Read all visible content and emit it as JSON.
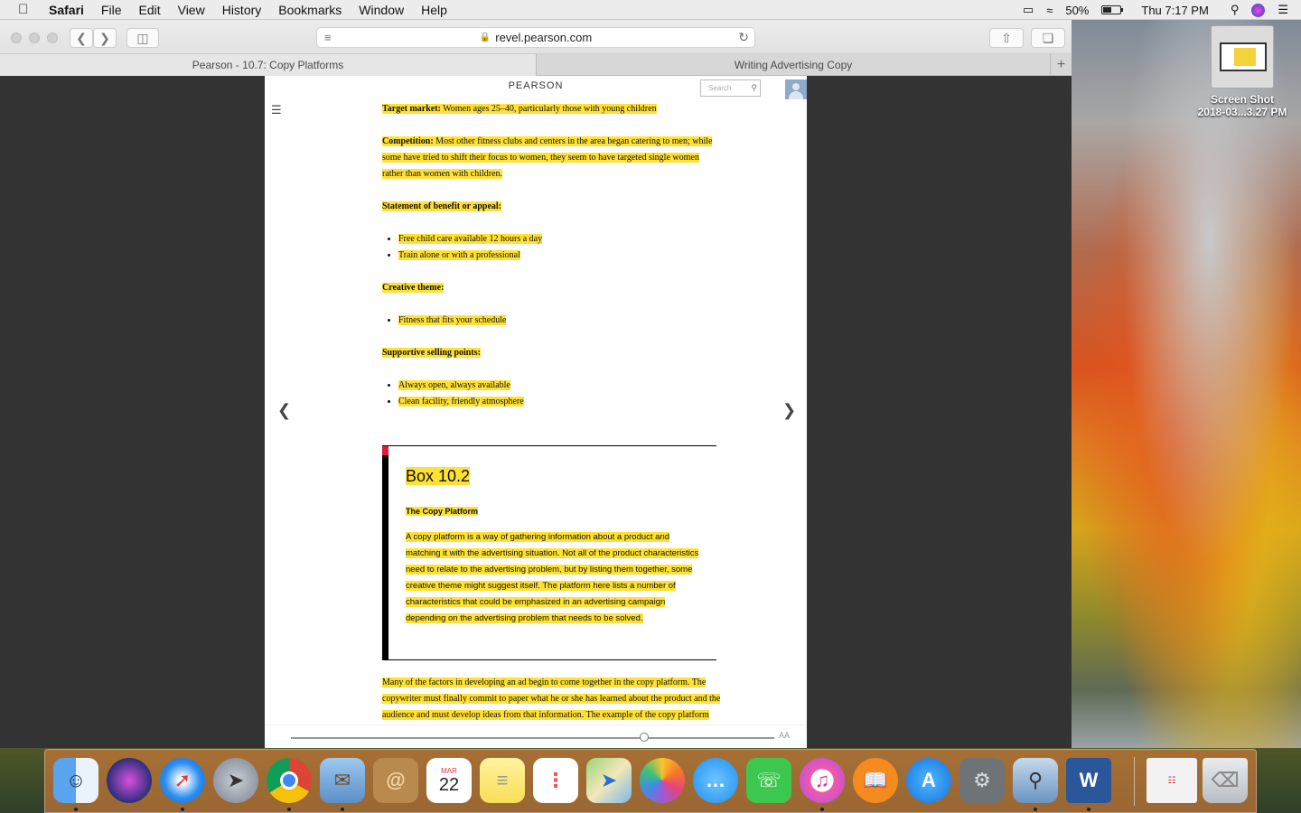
{
  "menubar": {
    "app_name": "Safari",
    "items": [
      "File",
      "Edit",
      "View",
      "History",
      "Bookmarks",
      "Window",
      "Help"
    ],
    "battery_percent": "50%",
    "clock": "Thu 7:17 PM"
  },
  "browser": {
    "url": "revel.pearson.com",
    "tabs": [
      {
        "title": "Pearson - 10.7: Copy Platforms",
        "active": true
      },
      {
        "title": "Writing Advertising Copy",
        "active": false
      }
    ]
  },
  "page": {
    "brand": "PEARSON",
    "search_placeholder": "Search",
    "target_market_label": "Target market:",
    "target_market_text": " Women ages 25–40, particularly those with young children",
    "competition_label": "Competition:",
    "competition_text": " Most other fitness clubs and centers in the area began catering to men; while some have tried to shift their focus to women, they seem to have targeted single women rather than women with children.",
    "benefit_label": "Statement of benefit or appeal:",
    "benefit_items": [
      "Free child care available 12 hours a day",
      "Train alone or with a professional"
    ],
    "creative_label": "Creative theme:",
    "creative_items": [
      "Fitness that fits your schedule"
    ],
    "selling_label": "Supportive selling points:",
    "selling_items": [
      "Always open, always available",
      "Clean facility, friendly atmosphere"
    ],
    "box_title": "Box 10.2",
    "box_subtitle": "The Copy Platform",
    "box_body": "A copy platform is a way of gathering information about a product and matching it with the advertising situation. Not all of the product characteristics need to relate to the advertising problem, but by listing them together, some creative theme might suggest itself. The platform here lists a number of characteristics that could be emphasized in an advertising campaign depending on the advertising problem that needs to be solved.",
    "after_text": "Many of the factors in developing an ad begin to come together in the copy platform. The copywriter must finally commit to paper what he or she has learned about the product and the audience and must develop ideas from that information. The example of the copy platform shows some of the elements that",
    "text_size_label": "AA",
    "reading_progress": 0.73
  },
  "desktop": {
    "icon_name_line1": "Screen Shot",
    "icon_name_line2": "2018-03...3.27 PM"
  },
  "dock": {
    "calendar_month": "MAR",
    "calendar_day": "22",
    "apps": [
      "finder-icon",
      "siri-icon",
      "safari-icon",
      "launchpad-icon",
      "chrome-icon",
      "mail-icon",
      "notes-icon",
      "calendar-icon",
      "stickies-icon",
      "reminders-icon",
      "maps-icon",
      "photos-icon",
      "messages-icon",
      "facetime-icon",
      "itunes-icon",
      "ibooks-icon",
      "app-store-icon",
      "system-preferences-icon",
      "preview-icon",
      "word-icon"
    ]
  }
}
